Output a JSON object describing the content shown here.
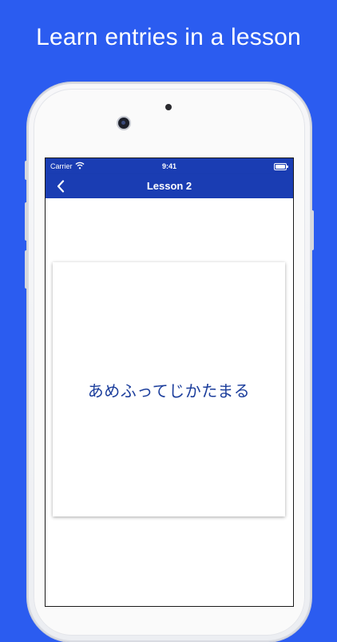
{
  "headline": "Learn entries in a lesson",
  "status_bar": {
    "carrier": "Carrier",
    "time": "9:41",
    "icons": [
      "wifi-icon",
      "battery-icon"
    ]
  },
  "nav_bar": {
    "back_icon": "chevron-left-icon",
    "title": "Lesson 2"
  },
  "card": {
    "text": "あめふってじかたまる"
  },
  "colors": {
    "background": "#2b5cf0",
    "nav_bar": "#1a3db3",
    "card_text": "#1c3e9c"
  }
}
